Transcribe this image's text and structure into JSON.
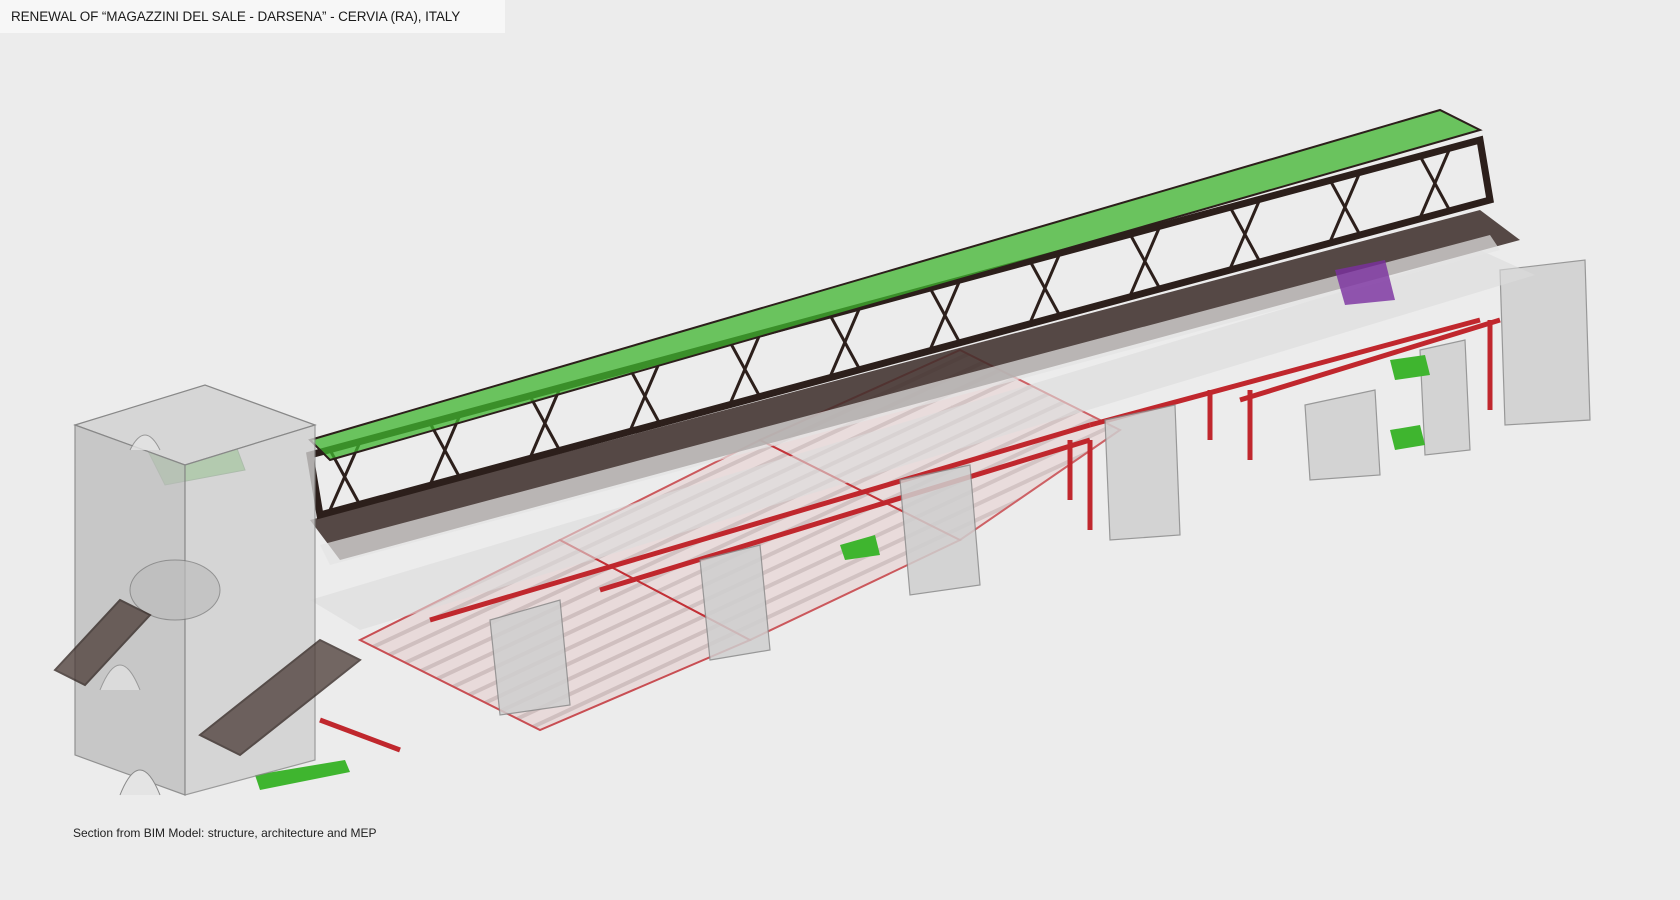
{
  "header": {
    "title": "RENEWAL OF “MAGAZZINI DEL SALE - DARSENA” - CERVIA (RA), ITALY"
  },
  "caption": {
    "text": "Section from BIM Model: structure, architecture and MEP"
  },
  "colors": {
    "background": "#ececec",
    "header_bg": "#f7f7f7",
    "steel_dark": "#2c1f1b",
    "mep_red": "#c0272d",
    "mep_green": "#3fb52f",
    "mep_purple": "#7a2fa0",
    "concrete": "#b9b9b9",
    "glass_fill": "#d9d9d9"
  },
  "legend_icons": [
    "truss-icon",
    "pipe-icon"
  ]
}
